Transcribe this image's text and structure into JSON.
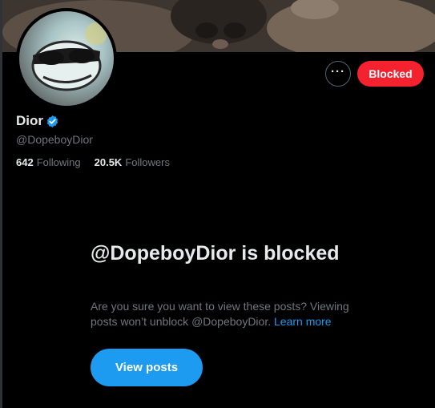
{
  "profile": {
    "display_name": "Dior",
    "handle": "@DopeboyDior",
    "following_count": "642",
    "following_label": "Following",
    "followers_count": "20.5K",
    "followers_label": "Followers"
  },
  "actions": {
    "more_label": "···",
    "blocked_label": "Blocked"
  },
  "blocked_notice": {
    "title": "@DopeboyDior is blocked",
    "description": "Are you sure you want to view these posts? Viewing posts won’t unblock @DopeboyDior.",
    "learn_more": "Learn more",
    "view_posts_label": "View posts"
  },
  "icons": {
    "verified": "verified-badge-icon",
    "more": "more-options-icon"
  },
  "colors": {
    "background": "#000000",
    "accent": "#1d9bf0",
    "blocked_red": "#f4212e",
    "text_primary": "#e7e9ea",
    "text_secondary": "#71767b"
  }
}
